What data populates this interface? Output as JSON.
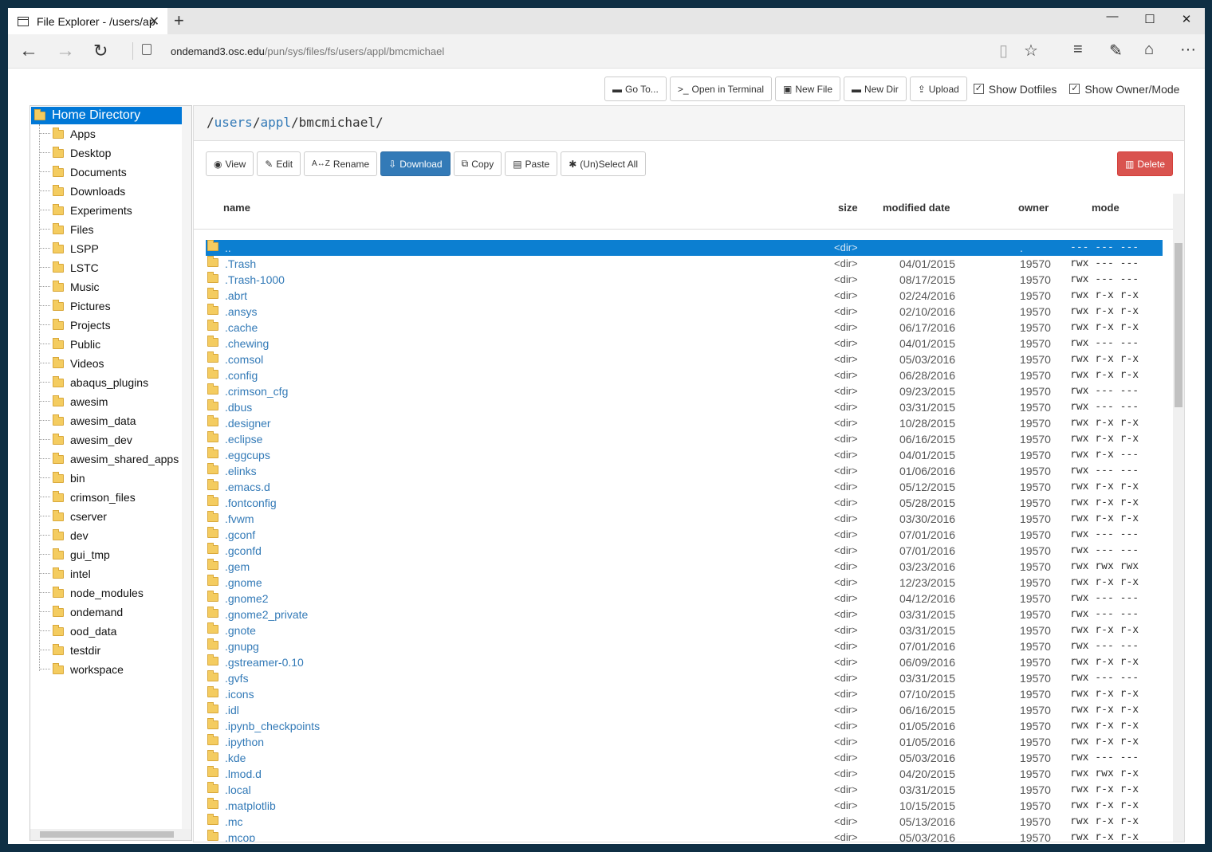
{
  "browser": {
    "tab_title": "File Explorer - /users/ap",
    "url_host": "ondemand3.osc.edu",
    "url_path": "/pun/sys/files/fs/users/appl/bmcmichael"
  },
  "toolbar": {
    "goto": "Go To...",
    "terminal": "Open in Terminal",
    "new_file": "New File",
    "new_dir": "New Dir",
    "upload": "Upload",
    "show_dotfiles": "Show Dotfiles",
    "show_owner_mode": "Show Owner/Mode"
  },
  "tree": {
    "root": "Home Directory",
    "items": [
      "Apps",
      "Desktop",
      "Documents",
      "Downloads",
      "Experiments",
      "Files",
      "LSPP",
      "LSTC",
      "Music",
      "Pictures",
      "Projects",
      "Public",
      "Videos",
      "abaqus_plugins",
      "awesim",
      "awesim_data",
      "awesim_dev",
      "awesim_shared_apps",
      "bin",
      "crimson_files",
      "cserver",
      "dev",
      "gui_tmp",
      "intel",
      "node_modules",
      "ondemand",
      "ood_data",
      "testdir",
      "workspace"
    ]
  },
  "path": {
    "seg1": "users",
    "seg2": "appl",
    "seg3": "bmcmichael",
    "sep": "/"
  },
  "actions": {
    "view": "View",
    "edit": "Edit",
    "rename": "Rename",
    "download": "Download",
    "copy": "Copy",
    "paste": "Paste",
    "select_all": "(Un)Select All",
    "delete": "Delete"
  },
  "columns": {
    "name": "name",
    "size": "size",
    "modified": "modified date",
    "owner": "owner",
    "mode": "mode"
  },
  "files": [
    {
      "name": "..",
      "size": "<dir>",
      "date": "",
      "owner": ".",
      "mode": "--- --- ---",
      "selected": true
    },
    {
      "name": ".Trash",
      "size": "<dir>",
      "date": "04/01/2015",
      "owner": "19570",
      "mode": "rwx --- ---"
    },
    {
      "name": ".Trash-1000",
      "size": "<dir>",
      "date": "08/17/2015",
      "owner": "19570",
      "mode": "rwx --- ---"
    },
    {
      "name": ".abrt",
      "size": "<dir>",
      "date": "02/24/2016",
      "owner": "19570",
      "mode": "rwx r-x r-x"
    },
    {
      "name": ".ansys",
      "size": "<dir>",
      "date": "02/10/2016",
      "owner": "19570",
      "mode": "rwx r-x r-x"
    },
    {
      "name": ".cache",
      "size": "<dir>",
      "date": "06/17/2016",
      "owner": "19570",
      "mode": "rwx r-x r-x"
    },
    {
      "name": ".chewing",
      "size": "<dir>",
      "date": "04/01/2015",
      "owner": "19570",
      "mode": "rwx --- ---"
    },
    {
      "name": ".comsol",
      "size": "<dir>",
      "date": "05/03/2016",
      "owner": "19570",
      "mode": "rwx r-x r-x"
    },
    {
      "name": ".config",
      "size": "<dir>",
      "date": "06/28/2016",
      "owner": "19570",
      "mode": "rwx r-x r-x"
    },
    {
      "name": ".crimson_cfg",
      "size": "<dir>",
      "date": "09/23/2015",
      "owner": "19570",
      "mode": "rwx --- ---"
    },
    {
      "name": ".dbus",
      "size": "<dir>",
      "date": "03/31/2015",
      "owner": "19570",
      "mode": "rwx --- ---"
    },
    {
      "name": ".designer",
      "size": "<dir>",
      "date": "10/28/2015",
      "owner": "19570",
      "mode": "rwx r-x r-x"
    },
    {
      "name": ".eclipse",
      "size": "<dir>",
      "date": "06/16/2015",
      "owner": "19570",
      "mode": "rwx r-x r-x"
    },
    {
      "name": ".eggcups",
      "size": "<dir>",
      "date": "04/01/2015",
      "owner": "19570",
      "mode": "rwx r-x ---"
    },
    {
      "name": ".elinks",
      "size": "<dir>",
      "date": "01/06/2016",
      "owner": "19570",
      "mode": "rwx --- ---"
    },
    {
      "name": ".emacs.d",
      "size": "<dir>",
      "date": "05/12/2015",
      "owner": "19570",
      "mode": "rwx r-x r-x"
    },
    {
      "name": ".fontconfig",
      "size": "<dir>",
      "date": "05/28/2015",
      "owner": "19570",
      "mode": "rwx r-x r-x"
    },
    {
      "name": ".fvwm",
      "size": "<dir>",
      "date": "03/30/2016",
      "owner": "19570",
      "mode": "rwx r-x r-x"
    },
    {
      "name": ".gconf",
      "size": "<dir>",
      "date": "07/01/2016",
      "owner": "19570",
      "mode": "rwx --- ---"
    },
    {
      "name": ".gconfd",
      "size": "<dir>",
      "date": "07/01/2016",
      "owner": "19570",
      "mode": "rwx --- ---"
    },
    {
      "name": ".gem",
      "size": "<dir>",
      "date": "03/23/2016",
      "owner": "19570",
      "mode": "rwx rwx rwx"
    },
    {
      "name": ".gnome",
      "size": "<dir>",
      "date": "12/23/2015",
      "owner": "19570",
      "mode": "rwx r-x r-x"
    },
    {
      "name": ".gnome2",
      "size": "<dir>",
      "date": "04/12/2016",
      "owner": "19570",
      "mode": "rwx --- ---"
    },
    {
      "name": ".gnome2_private",
      "size": "<dir>",
      "date": "03/31/2015",
      "owner": "19570",
      "mode": "rwx --- ---"
    },
    {
      "name": ".gnote",
      "size": "<dir>",
      "date": "03/31/2015",
      "owner": "19570",
      "mode": "rwx r-x r-x"
    },
    {
      "name": ".gnupg",
      "size": "<dir>",
      "date": "07/01/2016",
      "owner": "19570",
      "mode": "rwx --- ---"
    },
    {
      "name": ".gstreamer-0.10",
      "size": "<dir>",
      "date": "06/09/2016",
      "owner": "19570",
      "mode": "rwx r-x r-x"
    },
    {
      "name": ".gvfs",
      "size": "<dir>",
      "date": "03/31/2015",
      "owner": "19570",
      "mode": "rwx --- ---"
    },
    {
      "name": ".icons",
      "size": "<dir>",
      "date": "07/10/2015",
      "owner": "19570",
      "mode": "rwx r-x r-x"
    },
    {
      "name": ".idl",
      "size": "<dir>",
      "date": "06/16/2015",
      "owner": "19570",
      "mode": "rwx r-x r-x"
    },
    {
      "name": ".ipynb_checkpoints",
      "size": "<dir>",
      "date": "01/05/2016",
      "owner": "19570",
      "mode": "rwx r-x r-x"
    },
    {
      "name": ".ipython",
      "size": "<dir>",
      "date": "01/05/2016",
      "owner": "19570",
      "mode": "rwx r-x r-x"
    },
    {
      "name": ".kde",
      "size": "<dir>",
      "date": "05/03/2016",
      "owner": "19570",
      "mode": "rwx --- ---"
    },
    {
      "name": ".lmod.d",
      "size": "<dir>",
      "date": "04/20/2015",
      "owner": "19570",
      "mode": "rwx rwx r-x"
    },
    {
      "name": ".local",
      "size": "<dir>",
      "date": "03/31/2015",
      "owner": "19570",
      "mode": "rwx r-x r-x"
    },
    {
      "name": ".matplotlib",
      "size": "<dir>",
      "date": "10/15/2015",
      "owner": "19570",
      "mode": "rwx r-x r-x"
    },
    {
      "name": ".mc",
      "size": "<dir>",
      "date": "05/13/2016",
      "owner": "19570",
      "mode": "rwx r-x r-x"
    },
    {
      "name": ".mcop",
      "size": "<dir>",
      "date": "05/03/2016",
      "owner": "19570",
      "mode": "rwx r-x r-x"
    }
  ]
}
